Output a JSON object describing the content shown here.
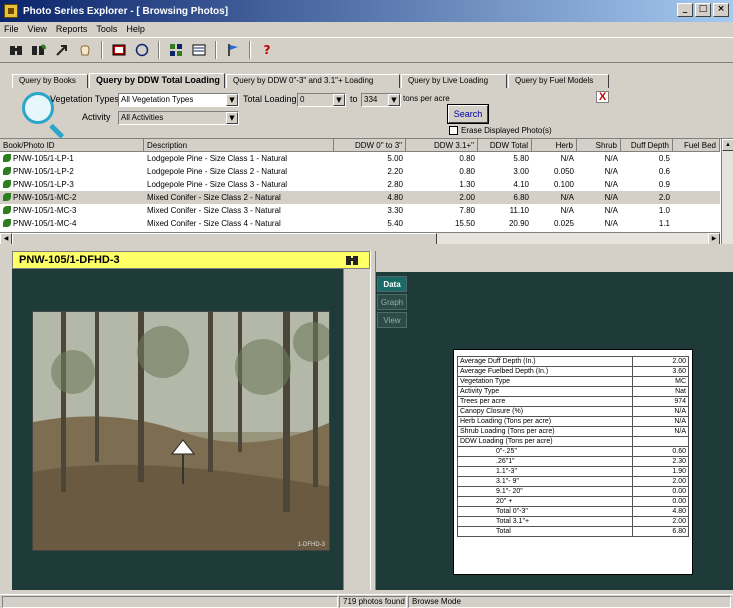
{
  "window": {
    "title": "Photo Series Explorer - [ Browsing Photos]",
    "buttons": [
      "_",
      "□",
      "×"
    ]
  },
  "menu": [
    "File",
    "View",
    "Reports",
    "Tools",
    "Help"
  ],
  "toolbar": {
    "icons": [
      "binoculars-icon",
      "binoculars-leaf-icon",
      "arrow-icon",
      "hand-icon",
      "photo-icon",
      "globe-icon",
      "grid-icon",
      "list-icon",
      "flag-icon",
      "help-icon"
    ],
    "help_label": "?"
  },
  "tabs": [
    {
      "label": "Query by Books",
      "active": false
    },
    {
      "label": "Query by DDW Total Loading",
      "active": true
    },
    {
      "label": "Query by DDW 0\"-3\" and 3.1\"+ Loading",
      "active": false
    },
    {
      "label": "Query by Live Loading",
      "active": false
    },
    {
      "label": "Query by Fuel Models",
      "active": false
    }
  ],
  "query": {
    "vegetation_label": "Vegetation Types",
    "vegetation_value": "All Vegetation Types",
    "activity_label": "Activity",
    "activity_value": "All Activities",
    "total_loading_label": "Total Loading",
    "loading_min": "0",
    "to_label": "to",
    "loading_max": "334",
    "units_label": "tons per acre",
    "search_label": "Search",
    "close_label": "X",
    "erase_label": "Erase Displayed Photo(s)"
  },
  "grid": {
    "columns": [
      "Book/Photo ID",
      "Description",
      "DDW 0\" to 3\"",
      "DDW 3.1+\"",
      "DDW Total",
      "Herb",
      "Shrub",
      "Duff Depth",
      "Fuel Bed"
    ],
    "rows": [
      {
        "id": "PNW-105/1-LP-1",
        "desc": "Lodgepole Pine - Size Class 1 - Natural",
        "ddw03": "5.00",
        "ddw31": "0.80",
        "total": "5.80",
        "herb": "N/A",
        "shrub": "N/A",
        "duff": "0.5",
        "selected": false
      },
      {
        "id": "PNW-105/1-LP-2",
        "desc": "Lodgepole Pine - Size Class 2 - Natural",
        "ddw03": "2.20",
        "ddw31": "0.80",
        "total": "3.00",
        "herb": "0.050",
        "shrub": "N/A",
        "duff": "0.6",
        "selected": false
      },
      {
        "id": "PNW-105/1-LP-3",
        "desc": "Lodgepole Pine - Size Class 3 - Natural",
        "ddw03": "2.80",
        "ddw31": "1.30",
        "total": "4.10",
        "herb": "0.100",
        "shrub": "N/A",
        "duff": "0.9",
        "selected": false
      },
      {
        "id": "PNW-105/1-MC-2",
        "desc": "Mixed Conifer - Size Class 2 - Natural",
        "ddw03": "4.80",
        "ddw31": "2.00",
        "total": "6.80",
        "herb": "N/A",
        "shrub": "N/A",
        "duff": "2.0",
        "selected": true
      },
      {
        "id": "PNW-105/1-MC-3",
        "desc": "Mixed Conifer - Size Class 3 - Natural",
        "ddw03": "3.30",
        "ddw31": "7.80",
        "total": "11.10",
        "herb": "N/A",
        "shrub": "N/A",
        "duff": "1.0",
        "selected": false
      },
      {
        "id": "PNW-105/1-MC-4",
        "desc": "Mixed Conifer - Size Class 4 - Natural",
        "ddw03": "5.40",
        "ddw31": "15.50",
        "total": "20.90",
        "herb": "0.025",
        "shrub": "N/A",
        "duff": "1.1",
        "selected": false
      }
    ]
  },
  "photo": {
    "id": "PNW-105/1-DFHD-3",
    "caption": "1-DFHD-3"
  },
  "side_tabs": [
    {
      "label": "Data",
      "active": true
    },
    {
      "label": "Graph",
      "active": false
    },
    {
      "label": "View",
      "active": false
    }
  ],
  "data_table": [
    {
      "label": "Average Duff Depth (In.)",
      "value": "2.00",
      "indent": false
    },
    {
      "label": "Average Fuelbed Depth (In.)",
      "value": "3.60",
      "indent": false
    },
    {
      "label": "Vegetation Type",
      "value": "MC",
      "indent": false
    },
    {
      "label": "Activity Type",
      "value": "Nat",
      "indent": false
    },
    {
      "label": "Trees per acre",
      "value": "974",
      "indent": false
    },
    {
      "label": "Canopy Closure (%)",
      "value": "N/A",
      "indent": false
    },
    {
      "label": "Herb Loading (Tons per acre)",
      "value": "N/A",
      "indent": false
    },
    {
      "label": "Shrub Loading (Tons per acre)",
      "value": "N/A",
      "indent": false
    },
    {
      "label": "DDW Loading (Tons per acre)",
      "value": "",
      "indent": false
    },
    {
      "label": "0\"-.25\"",
      "value": "0.60",
      "indent": true
    },
    {
      "label": ".26\"1\"",
      "value": "2.30",
      "indent": true
    },
    {
      "label": "1.1\"-3\"",
      "value": "1.90",
      "indent": true
    },
    {
      "label": "3.1\"- 9\"",
      "value": "2.00",
      "indent": true
    },
    {
      "label": "9.1\"- 20\"",
      "value": "0.00",
      "indent": true
    },
    {
      "label": "20\" +",
      "value": "0.00",
      "indent": true
    },
    {
      "label": "Total 0\"-3\"",
      "value": "4.80",
      "indent": true
    },
    {
      "label": "Total 3.1\"+",
      "value": "2.00",
      "indent": true
    },
    {
      "label": "Total",
      "value": "6.80",
      "indent": true
    }
  ],
  "status": {
    "count": "719 photos found",
    "mode": "Browse Mode"
  }
}
